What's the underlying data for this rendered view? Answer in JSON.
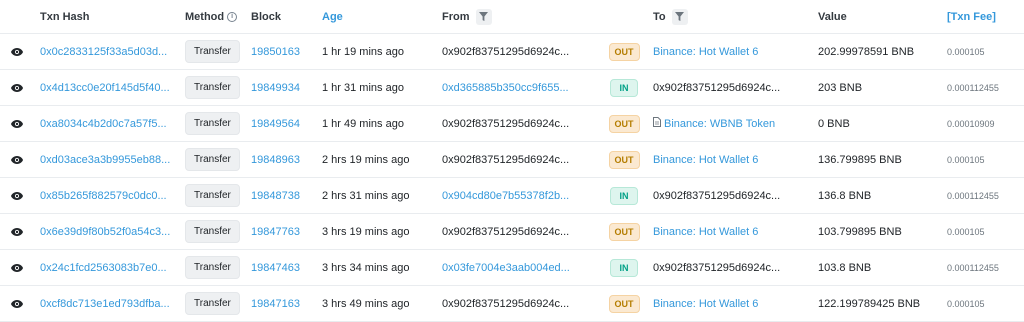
{
  "headers": {
    "txn_hash": "Txn Hash",
    "method": "Method",
    "block": "Block",
    "age": "Age",
    "from": "From",
    "to": "To",
    "value": "Value",
    "txn_fee": "[Txn Fee]"
  },
  "icons": {
    "view": "eye-icon",
    "info": "info-icon",
    "filter": "filter-icon",
    "contract": "document-icon"
  },
  "colors": {
    "link": "#3498db",
    "out_bg": "#fbe9d1",
    "out_text": "#b47d00",
    "in_bg": "#def5ee",
    "in_text": "#00a186"
  },
  "rows": [
    {
      "hash": "0x0c2833125f33a5d03d...",
      "method": "Transfer",
      "block": "19850163",
      "age": "1 hr 19 mins ago",
      "from": "0x902f83751295d6924c...",
      "from_link": false,
      "dir": "OUT",
      "to": "Binance: Hot Wallet 6",
      "to_link": true,
      "to_contract": false,
      "value": "202.99978591 BNB",
      "fee": "0.000105"
    },
    {
      "hash": "0x4d13cc0e20f145d5f40...",
      "method": "Transfer",
      "block": "19849934",
      "age": "1 hr 31 mins ago",
      "from": "0xd365885b350cc9f655...",
      "from_link": true,
      "dir": "IN",
      "to": "0x902f83751295d6924c...",
      "to_link": false,
      "to_contract": false,
      "value": "203 BNB",
      "fee": "0.000112455"
    },
    {
      "hash": "0xa8034c4b2d0c7a57f5...",
      "method": "Transfer",
      "block": "19849564",
      "age": "1 hr 49 mins ago",
      "from": "0x902f83751295d6924c...",
      "from_link": false,
      "dir": "OUT",
      "to": "Binance: WBNB Token",
      "to_link": true,
      "to_contract": true,
      "value": "0 BNB",
      "fee": "0.00010909"
    },
    {
      "hash": "0xd03ace3a3b9955eb88...",
      "method": "Transfer",
      "block": "19848963",
      "age": "2 hrs 19 mins ago",
      "from": "0x902f83751295d6924c...",
      "from_link": false,
      "dir": "OUT",
      "to": "Binance: Hot Wallet 6",
      "to_link": true,
      "to_contract": false,
      "value": "136.799895 BNB",
      "fee": "0.000105"
    },
    {
      "hash": "0x85b265f882579c0dc0...",
      "method": "Transfer",
      "block": "19848738",
      "age": "2 hrs 31 mins ago",
      "from": "0x904cd80e7b55378f2b...",
      "from_link": true,
      "dir": "IN",
      "to": "0x902f83751295d6924c...",
      "to_link": false,
      "to_contract": false,
      "value": "136.8 BNB",
      "fee": "0.000112455"
    },
    {
      "hash": "0x6e39d9f80b52f0a54c3...",
      "method": "Transfer",
      "block": "19847763",
      "age": "3 hrs 19 mins ago",
      "from": "0x902f83751295d6924c...",
      "from_link": false,
      "dir": "OUT",
      "to": "Binance: Hot Wallet 6",
      "to_link": true,
      "to_contract": false,
      "value": "103.799895 BNB",
      "fee": "0.000105"
    },
    {
      "hash": "0x24c1fcd2563083b7e0...",
      "method": "Transfer",
      "block": "19847463",
      "age": "3 hrs 34 mins ago",
      "from": "0x03fe7004e3aab004ed...",
      "from_link": true,
      "dir": "IN",
      "to": "0x902f83751295d6924c...",
      "to_link": false,
      "to_contract": false,
      "value": "103.8 BNB",
      "fee": "0.000112455"
    },
    {
      "hash": "0xcf8dc713e1ed793dfba...",
      "method": "Transfer",
      "block": "19847163",
      "age": "3 hrs 49 mins ago",
      "from": "0x902f83751295d6924c...",
      "from_link": false,
      "dir": "OUT",
      "to": "Binance: Hot Wallet 6",
      "to_link": true,
      "to_contract": false,
      "value": "122.199789425 BNB",
      "fee": "0.000105"
    }
  ]
}
